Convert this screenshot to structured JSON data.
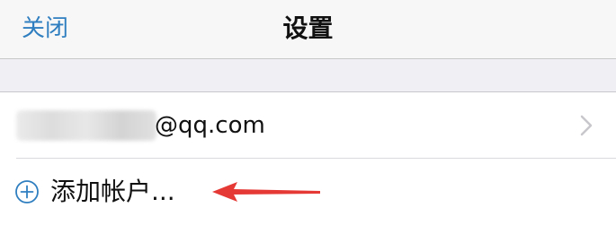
{
  "nav": {
    "close_label": "关闭",
    "title": "设置"
  },
  "account": {
    "email_suffix": "@qq.com",
    "email_prefix_redacted": true
  },
  "add_account": {
    "label": "添加帐户..."
  },
  "colors": {
    "accent": "#2f7fc0",
    "nav_background": "#f7f7f7",
    "group_background": "#efeff4",
    "annotation_arrow": "#e53935",
    "chevron": "#c7c7cc"
  },
  "icons": {
    "row_disclosure": "chevron-right-icon",
    "add_account": "circle-plus-icon",
    "annotation": "red-arrow-annotation"
  }
}
